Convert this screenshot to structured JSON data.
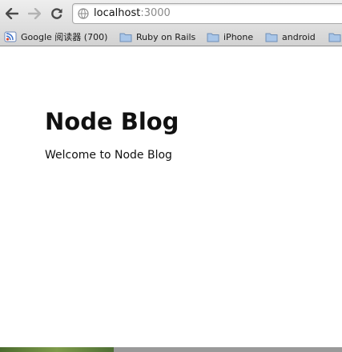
{
  "browser": {
    "back_icon": "back-arrow-icon",
    "forward_icon": "forward-arrow-icon",
    "reload_icon": "reload-icon",
    "page_icon": "globe-icon",
    "address": {
      "host": "localhost",
      "port": ":3000"
    }
  },
  "bookmarks": [
    {
      "label": "Google 阅读器 (700)",
      "icon": "google-reader-icon"
    },
    {
      "label": "Ruby on Rails",
      "icon": "folder-icon"
    },
    {
      "label": "iPhone",
      "icon": "folder-icon"
    },
    {
      "label": "android",
      "icon": "folder-icon"
    }
  ],
  "page": {
    "title": "Node Blog",
    "welcome": "Welcome to Node Blog"
  },
  "colors": {
    "folder": "#a9c6e8",
    "folder_border": "#6f8fb7",
    "url_port": "#8a8a8a"
  }
}
